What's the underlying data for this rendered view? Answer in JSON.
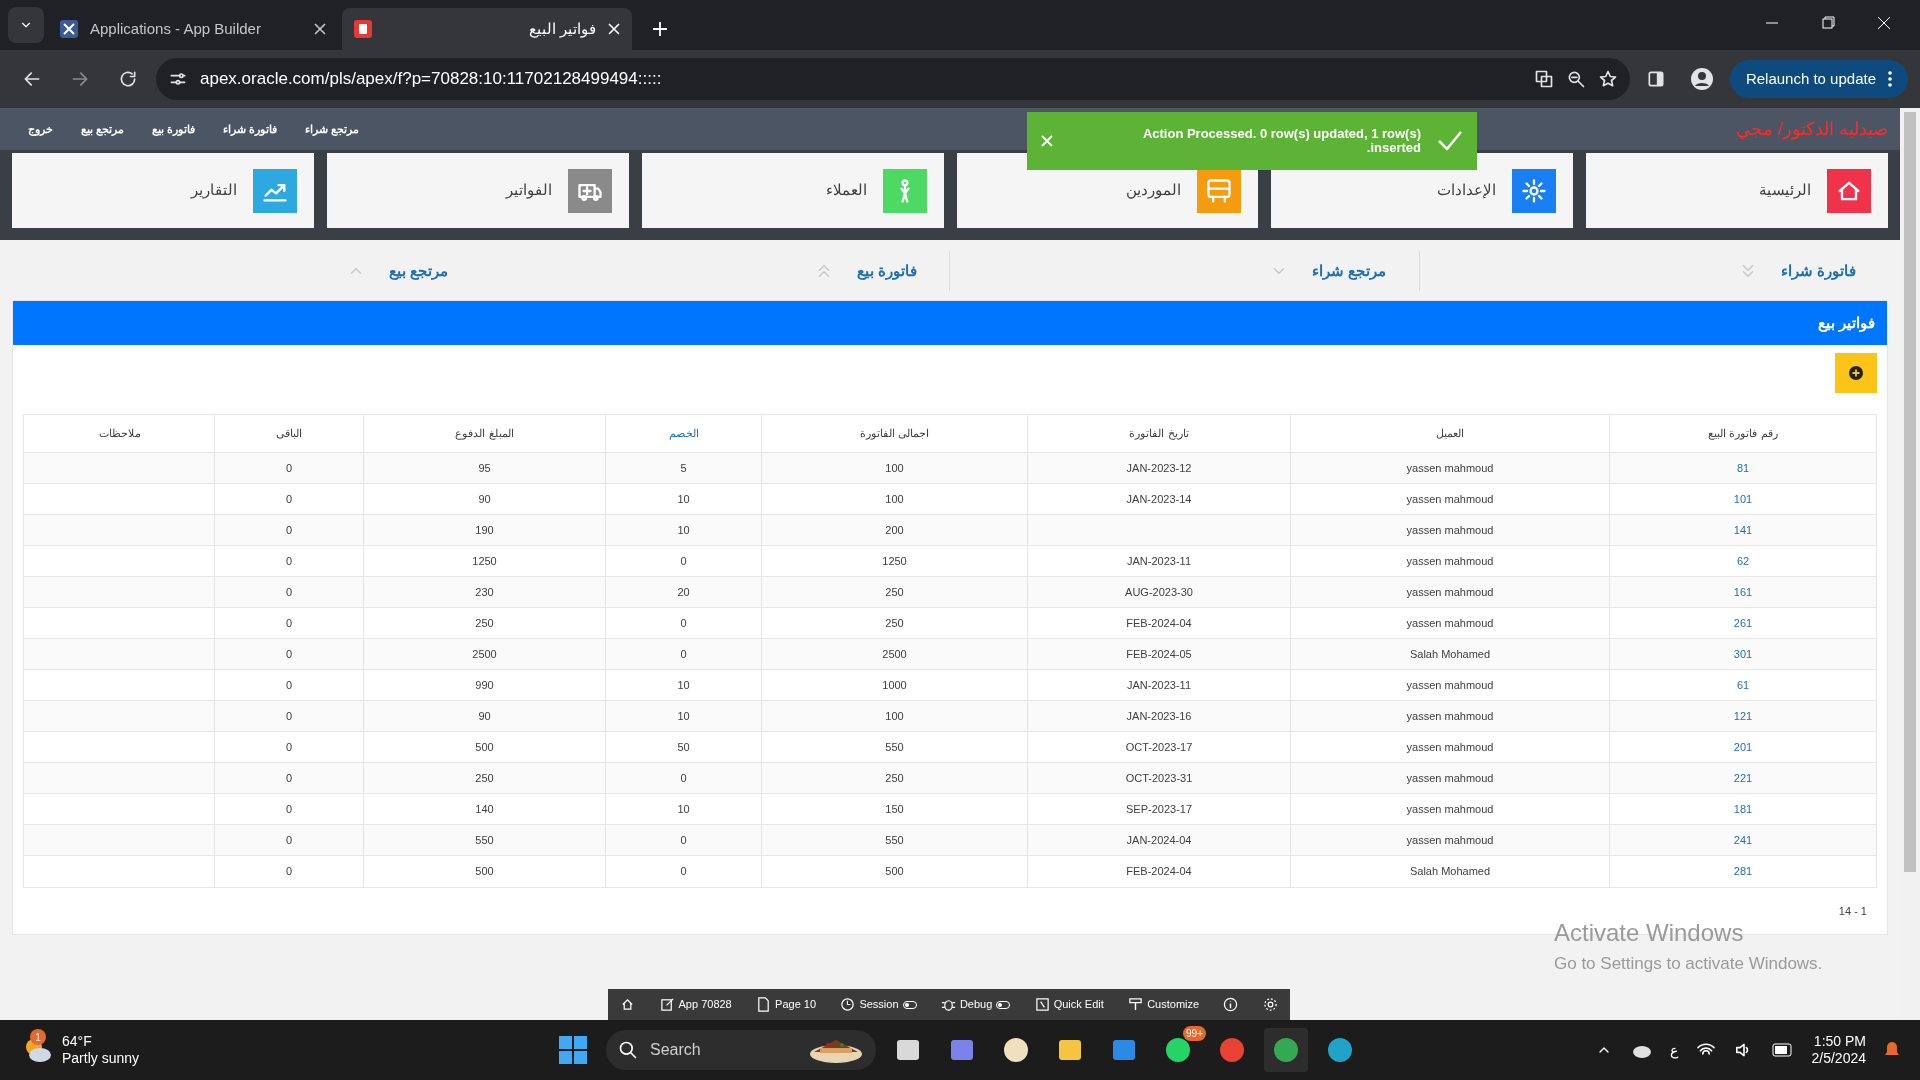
{
  "browser": {
    "tabs": [
      {
        "title": "Applications - App Builder",
        "selected": false
      },
      {
        "title": "فواتير البيع",
        "selected": true
      }
    ],
    "url": "apex.oracle.com/pls/apex/f?p=70828:10:11702128499494:::::",
    "relaunch": "Relaunch to update"
  },
  "app_bar": {
    "title": "صيدليه الدكتور/ مجي",
    "links": [
      "مرتجع شراء",
      "فاتورة شراء",
      "فاتورة بيع",
      "مرتجع بيع",
      "خروج"
    ]
  },
  "tiles": [
    {
      "label": "الرئيسية",
      "kind": "home",
      "color": "#f0324b"
    },
    {
      "label": "الإعدادات",
      "kind": "settings",
      "color": "#1a7ef5"
    },
    {
      "label": "الموردين",
      "kind": "bus",
      "color": "#f59b0f"
    },
    {
      "label": "العملاء",
      "kind": "person",
      "color": "#4cd964"
    },
    {
      "label": "الفواتير",
      "kind": "ambulance",
      "color": "#8a8a8a"
    },
    {
      "label": "التقارير",
      "kind": "chart",
      "color": "#2ea8e0"
    }
  ],
  "toast": {
    "lines": [
      "Action Processed. 0 row(s) updated, 1 row(s)",
      ".inserted"
    ]
  },
  "sections": [
    {
      "label": "فاتورة شراء",
      "expanded": false,
      "kind": "double"
    },
    {
      "label": "مرتجع شراء",
      "expanded": false,
      "kind": "single"
    },
    {
      "label": "فاتورة بيع",
      "expanded": true,
      "kind": "double"
    },
    {
      "label": "مرتجع بيع",
      "expanded": true,
      "kind": "single"
    }
  ],
  "report": {
    "title": "فواتير بيع",
    "columns": [
      {
        "label": "رقم فاتورة البيع",
        "sortable": false
      },
      {
        "label": "العميل",
        "sortable": false
      },
      {
        "label": "تاريخ الفاتورة",
        "sortable": false
      },
      {
        "label": "اجمالى الفاتورة",
        "sortable": false
      },
      {
        "label": "الخصم",
        "sortable": true
      },
      {
        "label": "المبلغ الدفوع",
        "sortable": false
      },
      {
        "label": "الباقى",
        "sortable": false
      },
      {
        "label": "ملاحظات",
        "sortable": false
      }
    ],
    "rows": [
      {
        "number": "81",
        "customer": "yassen mahmoud",
        "date": "JAN-2023-12",
        "total": "100",
        "discount": "5",
        "paid": "95",
        "remaining": "0"
      },
      {
        "number": "101",
        "customer": "yassen mahmoud",
        "date": "JAN-2023-14",
        "total": "100",
        "discount": "10",
        "paid": "90",
        "remaining": "0"
      },
      {
        "number": "141",
        "customer": "yassen mahmoud",
        "total": "200",
        "discount": "10",
        "paid": "190",
        "remaining": "0"
      },
      {
        "number": "62",
        "customer": "yassen mahmoud",
        "date": "JAN-2023-11",
        "total": "1250",
        "discount": "0",
        "paid": "1250",
        "remaining": "0"
      },
      {
        "number": "161",
        "customer": "yassen mahmoud",
        "date": "AUG-2023-30",
        "total": "250",
        "discount": "20",
        "paid": "230",
        "remaining": "0"
      },
      {
        "number": "261",
        "customer": "yassen mahmoud",
        "date": "FEB-2024-04",
        "total": "250",
        "discount": "0",
        "paid": "250",
        "remaining": "0"
      },
      {
        "number": "301",
        "customer": "Salah Mohamed",
        "date": "FEB-2024-05",
        "total": "2500",
        "discount": "0",
        "paid": "2500",
        "remaining": "0"
      },
      {
        "number": "61",
        "customer": "yassen mahmoud",
        "date": "JAN-2023-11",
        "total": "1000",
        "discount": "10",
        "paid": "990",
        "remaining": "0"
      },
      {
        "number": "121",
        "customer": "yassen mahmoud",
        "date": "JAN-2023-16",
        "total": "100",
        "discount": "10",
        "paid": "90",
        "remaining": "0"
      },
      {
        "number": "201",
        "customer": "yassen mahmoud",
        "date": "OCT-2023-17",
        "total": "550",
        "discount": "50",
        "paid": "500",
        "remaining": "0"
      },
      {
        "number": "221",
        "customer": "yassen mahmoud",
        "date": "OCT-2023-31",
        "total": "250",
        "discount": "0",
        "paid": "250",
        "remaining": "0"
      },
      {
        "number": "181",
        "customer": "yassen mahmoud",
        "date": "SEP-2023-17",
        "total": "150",
        "discount": "10",
        "paid": "140",
        "remaining": "0"
      },
      {
        "number": "241",
        "customer": "yassen mahmoud",
        "date": "JAN-2024-04",
        "total": "550",
        "discount": "0",
        "paid": "550",
        "remaining": "0"
      },
      {
        "number": "281",
        "customer": "Salah Mohamed",
        "date": "FEB-2024-04",
        "total": "500",
        "discount": "0",
        "paid": "500",
        "remaining": "0"
      }
    ],
    "pagination": "14 - 1"
  },
  "dev_toolbar": [
    {
      "kind": "home"
    },
    {
      "label": "App 70828",
      "kind": "edit"
    },
    {
      "label": "Page 10",
      "kind": "page"
    },
    {
      "label": "Session",
      "kind": "session"
    },
    {
      "label": "Debug",
      "kind": "debug"
    },
    {
      "label": "Quick Edit",
      "kind": "quick"
    },
    {
      "label": "Customize",
      "kind": "customize"
    },
    {
      "kind": "info"
    },
    {
      "kind": "gear"
    }
  ],
  "activation": {
    "title": "Activate Windows",
    "hint": "Go to Settings to activate Windows."
  },
  "taskbar": {
    "weather_temp": "64°F",
    "weather_text": "Partly sunny",
    "weather_badge": "1",
    "search": "Search",
    "chat_badge": "99+",
    "language": "ع",
    "time": "1:50 PM",
    "date": "2/5/2024"
  }
}
